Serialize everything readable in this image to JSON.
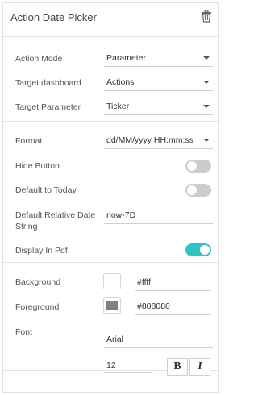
{
  "header": {
    "title": "Action Date Picker",
    "delete_icon": "trash-icon"
  },
  "action": {
    "mode_label": "Action Mode",
    "mode_value": "Parameter",
    "dashboard_label": "Target dashboard",
    "dashboard_value": "Actions",
    "parameter_label": "Target Parameter",
    "parameter_value": "Ticker"
  },
  "options": {
    "format_label": "Format",
    "format_value": "dd/MM/yyyy HH:mm:ss",
    "hide_button_label": "Hide Button",
    "hide_button_on": false,
    "default_today_label": "Default to Today",
    "default_today_on": false,
    "relative_label_1": "Default Relative Date",
    "relative_label_2": "String",
    "relative_value": "now-7D",
    "pdf_label": "Display In Pdf",
    "pdf_on": true
  },
  "style": {
    "background_label": "Background",
    "background_value": "#ffff",
    "background_color": "#ffffff",
    "foreground_label": "Foreground",
    "foreground_value": "#808080",
    "foreground_color": "#808080",
    "font_label": "Font",
    "font_value": "Arial",
    "font_size": "12",
    "bold_label": "B",
    "italic_label": "I"
  },
  "colors": {
    "toggle_on": "#2ec4c4",
    "toggle_off": "#cccccc"
  }
}
